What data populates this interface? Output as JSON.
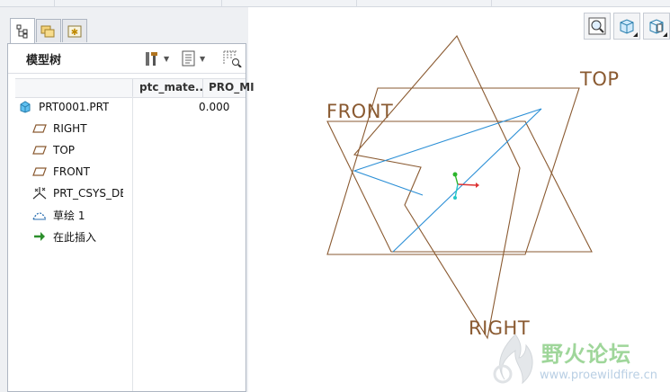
{
  "tabs": [
    {
      "icon": "model-tree-icon"
    },
    {
      "icon": "folder-browser-icon"
    },
    {
      "icon": "favorites-icon"
    }
  ],
  "tree": {
    "title": "模型树",
    "tools": [
      {
        "icon": "tools-icon"
      },
      {
        "icon": "show-list-icon"
      },
      {
        "icon": "filter-columns-icon"
      }
    ],
    "columns": [
      "ptc_mate...",
      "PRO_MI"
    ],
    "items": [
      {
        "label": "PRT0001.PRT",
        "value": "0.000",
        "icon": "part-icon"
      },
      {
        "label": "RIGHT",
        "icon": "datum-plane-icon"
      },
      {
        "label": "TOP",
        "icon": "datum-plane-icon"
      },
      {
        "label": "FRONT",
        "icon": "datum-plane-icon"
      },
      {
        "label": "PRT_CSYS_DEF",
        "icon": "coordinate-system-icon"
      },
      {
        "label": "草绘 1",
        "icon": "sketch-icon"
      },
      {
        "label": "在此插入",
        "icon": "insert-here-arrow-icon"
      }
    ]
  },
  "viewport": {
    "planes": {
      "front": "FRONT",
      "top": "TOP",
      "right": "RIGHT"
    },
    "colors": {
      "plane": "#8a5a31",
      "sketch": "#2b8fd6"
    },
    "view_tools": [
      {
        "icon": "zoom-fit-icon"
      },
      {
        "icon": "saved-views-icon"
      },
      {
        "icon": "display-style-icon"
      }
    ]
  },
  "watermark": {
    "title": "野火论坛",
    "url": "www.proewildfire.cn"
  }
}
